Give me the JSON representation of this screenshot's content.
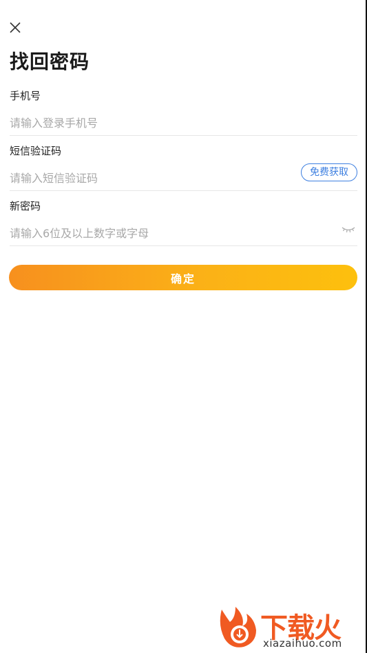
{
  "header": {
    "close_icon": "close-icon",
    "title": "找回密码"
  },
  "form": {
    "phone": {
      "label": "手机号",
      "placeholder": "请输入登录手机号"
    },
    "sms_code": {
      "label": "短信验证码",
      "placeholder": "请输入短信验证码",
      "button_label": "免费获取"
    },
    "new_password": {
      "label": "新密码",
      "placeholder": "请输入6位及以上数字或字母",
      "toggle_icon": "eye-closed-icon"
    },
    "submit_label": "确定"
  },
  "watermark": {
    "brand": "下载火",
    "domain": "xiazaihuo.com",
    "logo_icon": "fire-download-logo"
  },
  "colors": {
    "accent_blue": "#3d7fe0",
    "button_gradient_start": "#f7901e",
    "button_gradient_end": "#fdc00d",
    "watermark_orange": "#f05a22"
  }
}
